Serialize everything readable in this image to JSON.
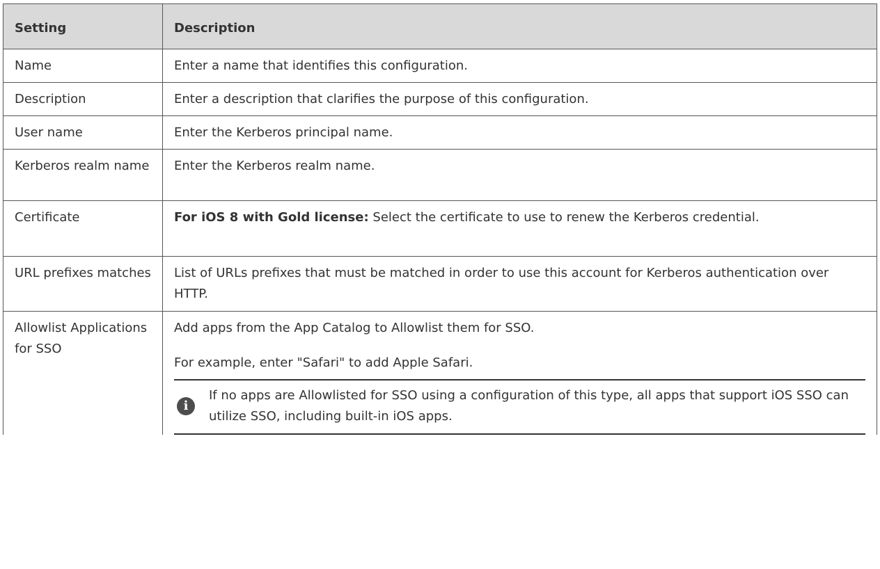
{
  "table": {
    "headers": [
      "Setting",
      "Description"
    ],
    "rows": [
      {
        "setting": "Name",
        "description": "Enter a name that identifies this configuration."
      },
      {
        "setting": "Description",
        "description": "Enter a description that clarifies the purpose of this configuration."
      },
      {
        "setting": "User name",
        "description": "Enter the Kerberos principal name."
      },
      {
        "setting": "Kerberos realm name",
        "description": "Enter the Kerberos realm name."
      },
      {
        "setting": "Certificate",
        "description_bold": "For iOS 8 with Gold license:",
        "description": " Select the certificate to use to renew the Kerberos credential."
      },
      {
        "setting": "URL prefixes matches",
        "description": "List of URLs prefixes that must be matched in order to use this account for Kerberos authentication over HTTP."
      },
      {
        "setting": "Allowlist Applications for SSO",
        "description": "Add apps from the App Catalog to Allowlist them for SSO.",
        "example": "For example, enter \"Safari\" to add Apple Safari.",
        "note": "If no apps are Allowlisted for SSO using a configuration of this type, all apps that support iOS SSO can utilize SSO, including built-in iOS apps.",
        "note_icon": "info-icon"
      }
    ]
  }
}
